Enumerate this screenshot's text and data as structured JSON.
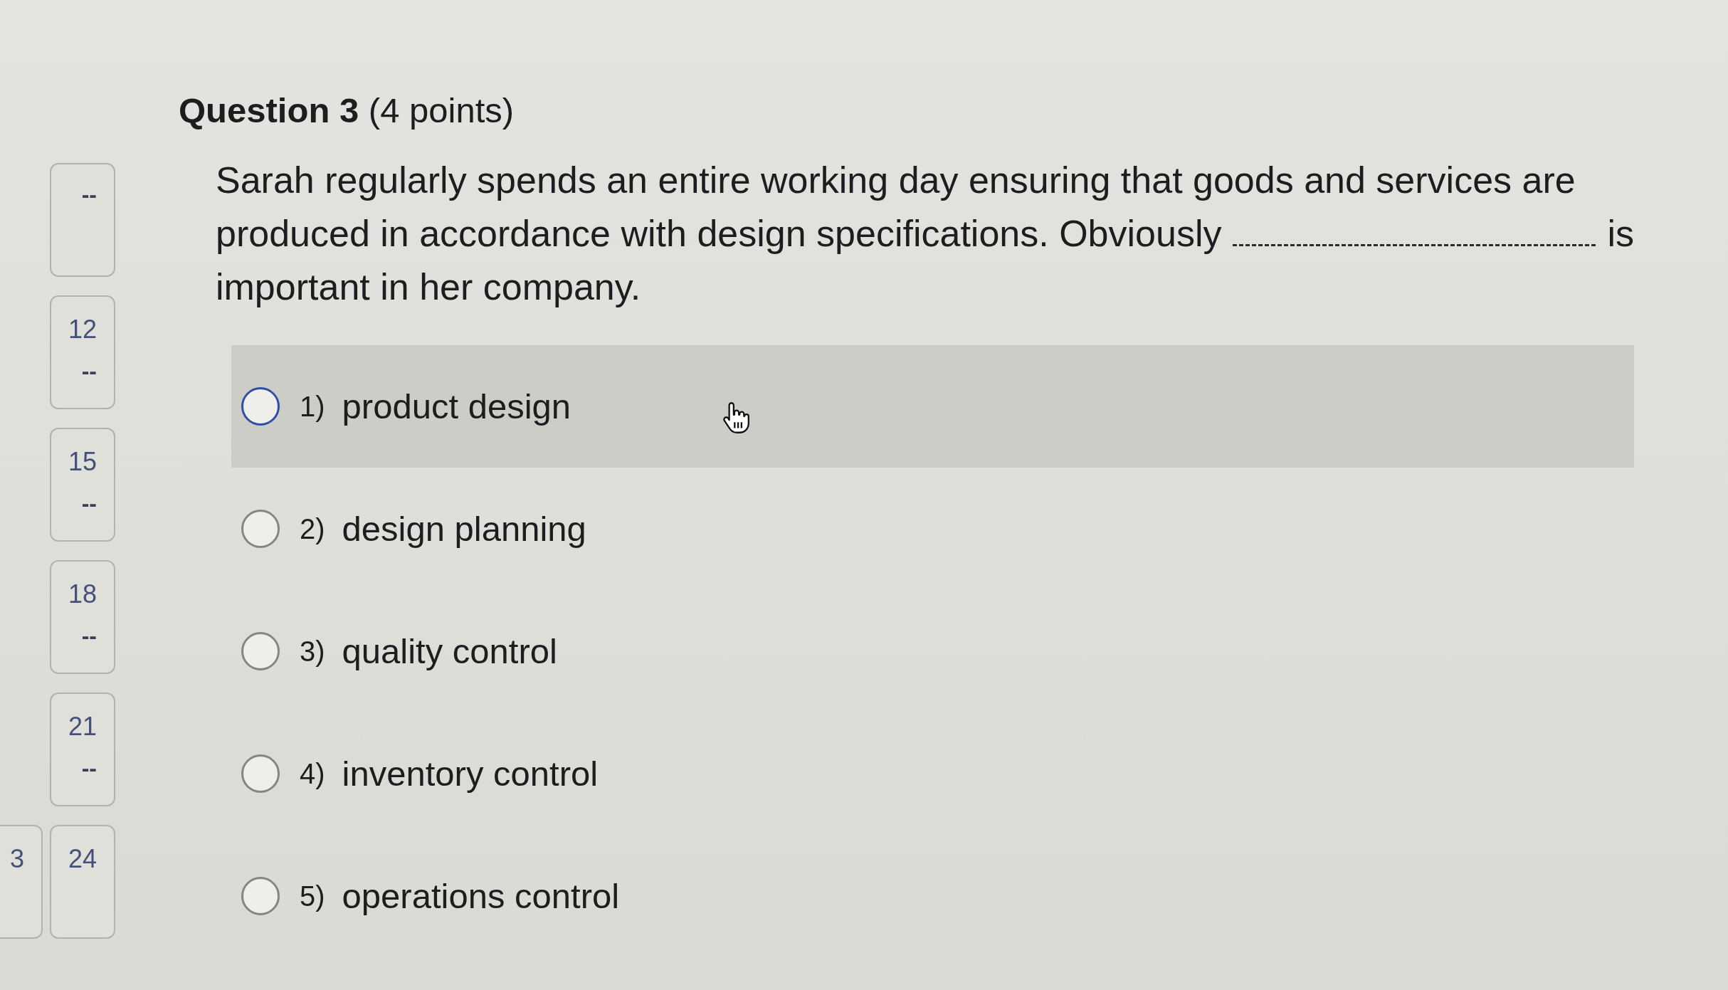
{
  "question_nav": [
    {
      "cards": [
        {
          "status": "--"
        }
      ]
    },
    {
      "cards": [
        {
          "number": "12",
          "status": "--"
        }
      ]
    },
    {
      "cards": [
        {
          "number": "15",
          "status": "--"
        }
      ]
    },
    {
      "cards": [
        {
          "number": "18",
          "status": "--"
        }
      ]
    },
    {
      "cards": [
        {
          "number": "21",
          "status": "--"
        }
      ]
    },
    {
      "cards": [
        {
          "number": "3"
        },
        {
          "number": "24"
        }
      ]
    }
  ],
  "question": {
    "title": "**Question 3** (4 points)",
    "prompt_lines": [
      [
        {
          "kind": "text",
          "text": "Sarah regularly spends an entire working day ensuring that goods and services are"
        }
      ],
      [
        {
          "kind": "text",
          "text": "produced in accordance with design specifications. Obviously"
        },
        {
          "kind": "blank"
        },
        {
          "kind": "text",
          "text": "is"
        }
      ],
      [
        {
          "kind": "text",
          "text": "important in her company."
        }
      ]
    ],
    "options": [
      {
        "number": "1)",
        "label": "product design",
        "selected": false,
        "highlighted": true
      },
      {
        "number": "2)",
        "label": "design planning",
        "selected": false,
        "highlighted": false
      },
      {
        "number": "3)",
        "label": "quality control",
        "selected": false,
        "highlighted": false
      },
      {
        "number": "4)",
        "label": "inventory control",
        "selected": false,
        "highlighted": false
      },
      {
        "number": "5)",
        "label": "operations control",
        "selected": false,
        "highlighted": false
      }
    ]
  }
}
